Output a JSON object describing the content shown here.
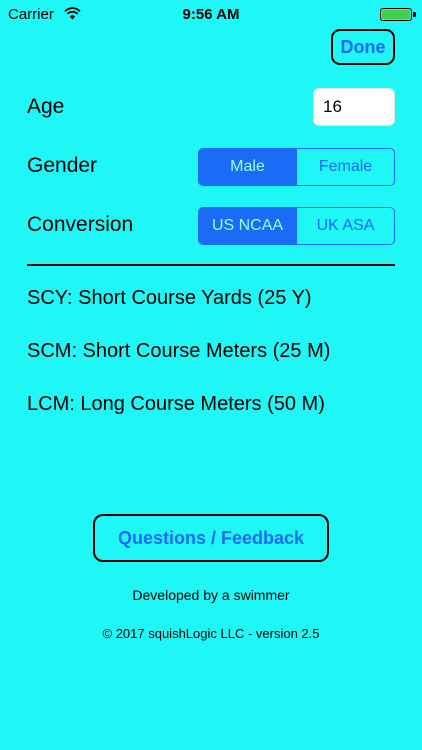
{
  "status": {
    "carrier": "Carrier",
    "time": "9:56 AM"
  },
  "toolbar": {
    "done_label": "Done"
  },
  "form": {
    "age": {
      "label": "Age",
      "value": "16"
    },
    "gender": {
      "label": "Gender",
      "options": [
        "Male",
        "Female"
      ],
      "selected": "Male"
    },
    "conversion": {
      "label": "Conversion",
      "options": [
        "US NCAA",
        "UK ASA"
      ],
      "selected": "US NCAA"
    }
  },
  "courses": [
    "SCY: Short Course Yards (25 Y)",
    "SCM: Short Course Meters (25 M)",
    "LCM: Long Course Meters (50 M)"
  ],
  "feedback": {
    "label": "Questions / Feedback"
  },
  "footer": {
    "tagline": "Developed by a swimmer",
    "copyright": "© 2017 squishLogic LLC - version 2.5"
  },
  "colors": {
    "background": "#1ff7f7",
    "accent": "#1a6bf5",
    "battery": "#3dd24c"
  },
  "icons": [
    "wifi-icon",
    "battery-icon"
  ],
  "battery_level": 1.0
}
